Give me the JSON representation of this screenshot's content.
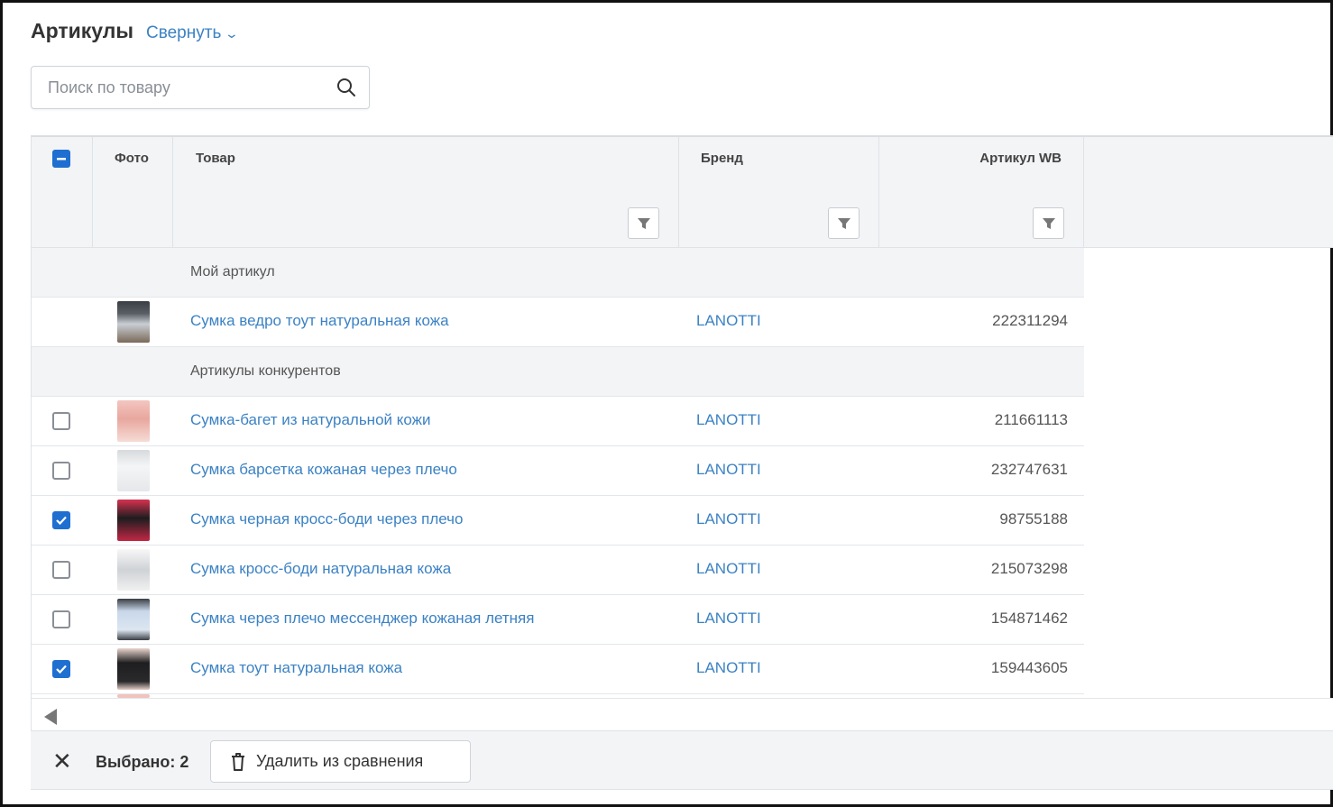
{
  "header": {
    "title": "Артикулы",
    "collapse_label": "Свернуть"
  },
  "search": {
    "placeholder": "Поиск по товару"
  },
  "columns": {
    "photo": "Фото",
    "product": "Товар",
    "brand": "Бренд",
    "sku": "Артикул WB"
  },
  "groups": {
    "mine": "Мой артикул",
    "competitors": "Артикулы конкурентов"
  },
  "my_item": {
    "product": "Сумка ведро тоут натуральная кожа",
    "brand": "LANOTTI",
    "sku": "222311294"
  },
  "competitors": [
    {
      "product": "Сумка-багет из натуральной кожи",
      "brand": "LANOTTI",
      "sku": "211661113",
      "checked": false
    },
    {
      "product": "Сумка барсетка кожаная через плечо",
      "brand": "LANOTTI",
      "sku": "232747631",
      "checked": false
    },
    {
      "product": "Сумка черная кросс-боди через плечо",
      "brand": "LANOTTI",
      "sku": "98755188",
      "checked": true
    },
    {
      "product": "Сумка кросс-боди натуральная кожа",
      "brand": "LANOTTI",
      "sku": "215073298",
      "checked": false
    },
    {
      "product": "Сумка через плечо мессенджер кожаная летняя",
      "brand": "LANOTTI",
      "sku": "154871462",
      "checked": false
    },
    {
      "product": "Сумка тоут натуральная кожа",
      "brand": "LANOTTI",
      "sku": "159443605",
      "checked": true
    }
  ],
  "footer": {
    "selected_label": "Выбрано: 2",
    "delete_label": "Удалить из сравнения"
  },
  "colors": {
    "accent": "#3b82c4",
    "checkbox_on": "#1f6fd1"
  }
}
